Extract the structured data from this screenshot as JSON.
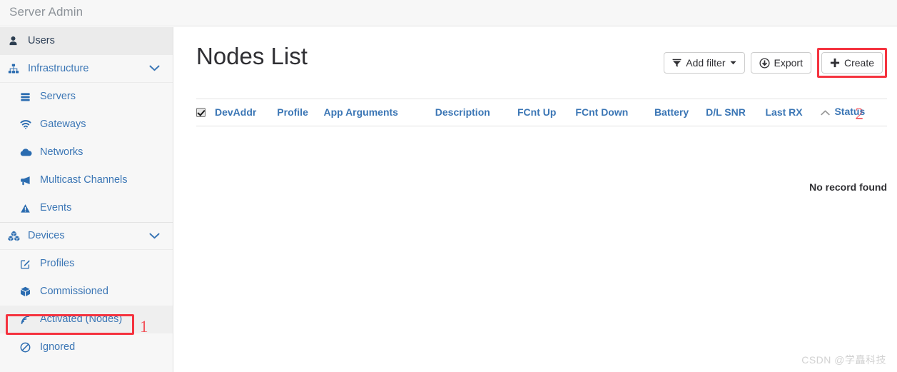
{
  "header": {
    "brand": "Server Admin"
  },
  "sidebar": {
    "items": [
      {
        "label": "Users",
        "icon": "user-icon",
        "level": "top",
        "state": "active"
      },
      {
        "label": "Infrastructure",
        "icon": "sitemap-icon",
        "level": "group",
        "state": "expanded",
        "chevron": "chevron-down-icon"
      },
      {
        "label": "Servers",
        "icon": "server-icon",
        "level": "sub",
        "state": "normal"
      },
      {
        "label": "Gateways",
        "icon": "wifi-icon",
        "level": "sub",
        "state": "normal"
      },
      {
        "label": "Networks",
        "icon": "cloud-icon",
        "level": "sub",
        "state": "normal"
      },
      {
        "label": "Multicast Channels",
        "icon": "bullhorn-icon",
        "level": "sub",
        "state": "normal"
      },
      {
        "label": "Events",
        "icon": "warning-triangle-icon",
        "level": "sub",
        "state": "normal"
      },
      {
        "label": "Devices",
        "icon": "cubes-icon",
        "level": "group",
        "state": "expanded",
        "chevron": "chevron-down-icon"
      },
      {
        "label": "Profiles",
        "icon": "edit-square-icon",
        "level": "sub",
        "state": "normal"
      },
      {
        "label": "Commissioned",
        "icon": "cube-icon",
        "level": "sub",
        "state": "normal"
      },
      {
        "label": "Activated (Nodes)",
        "icon": "rss-signal-icon",
        "level": "sub",
        "state": "highlighted"
      },
      {
        "label": "Ignored",
        "icon": "ban-icon",
        "level": "sub",
        "state": "normal"
      }
    ]
  },
  "main": {
    "page_title": "Nodes List",
    "toolbar": {
      "add_filter_label": "Add filter",
      "export_label": "Export",
      "create_label": "Create"
    },
    "table": {
      "select_all_checked": true,
      "columns": [
        "DevAddr",
        "Profile",
        "App Arguments",
        "Description",
        "FCnt Up",
        "FCnt Down",
        "Battery",
        "D/L SNR",
        "Last RX",
        "Status"
      ],
      "sorted_column": "Status",
      "sort_direction": "asc",
      "rows": [],
      "empty_message": "No record found"
    }
  },
  "annotations": {
    "marker_one": "1",
    "marker_two": "2",
    "highlight_color": "#f5333f"
  },
  "watermark": "CSDN @学矗科技"
}
